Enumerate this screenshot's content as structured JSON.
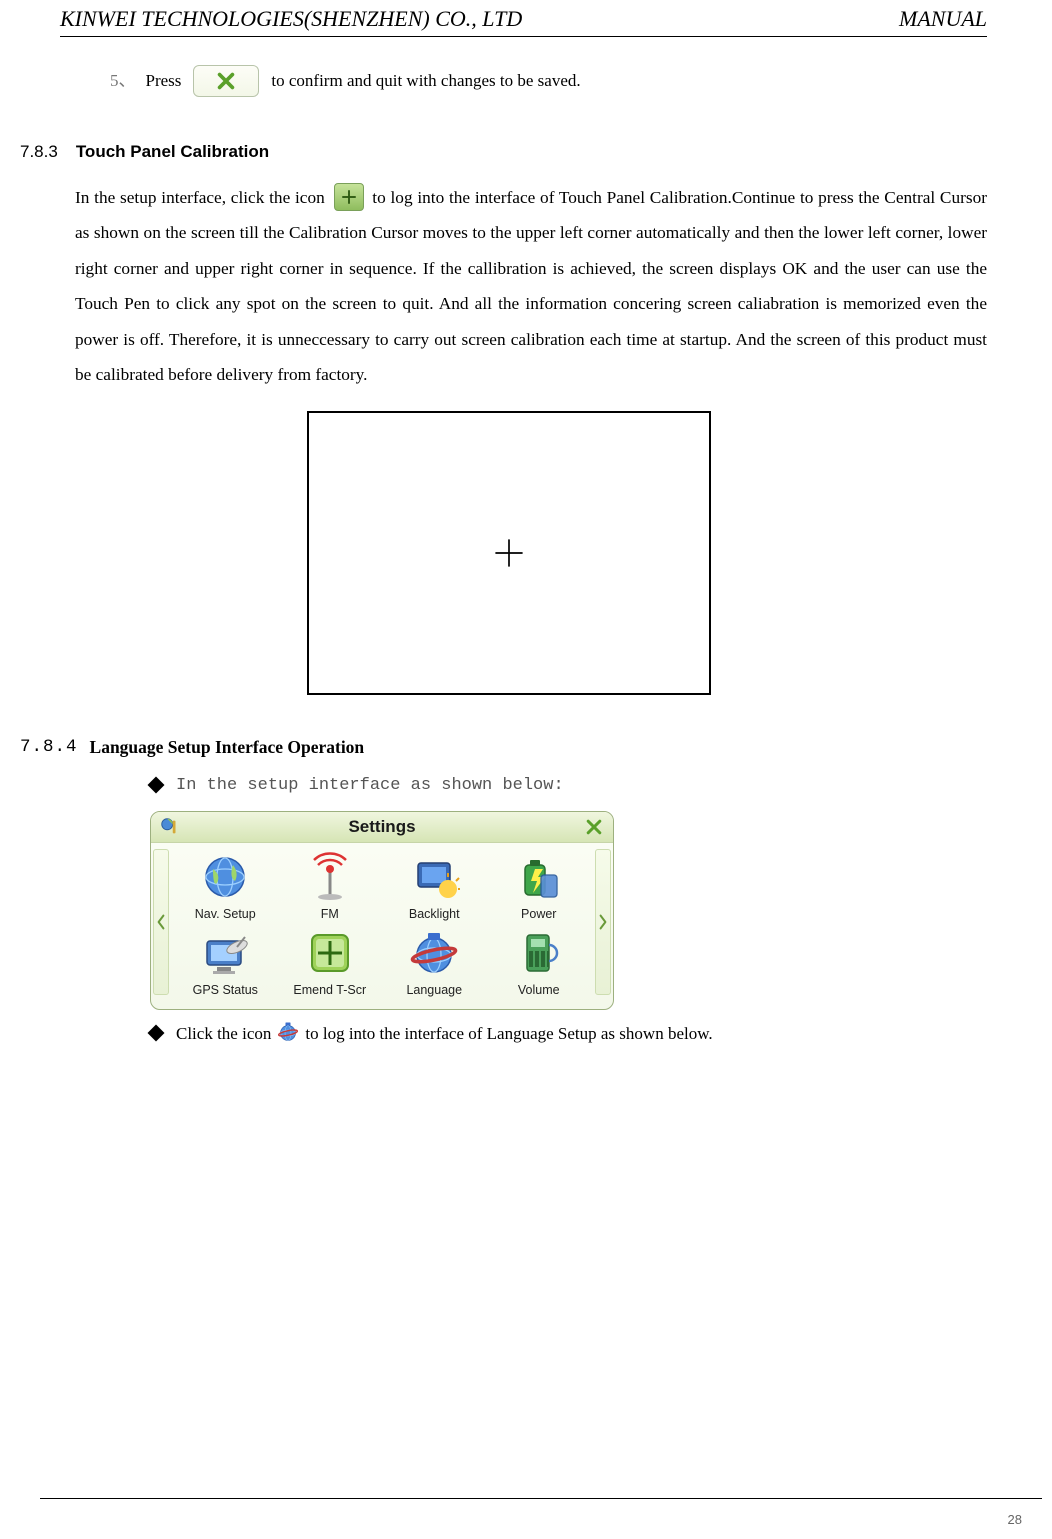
{
  "header": {
    "company": "KINWEI TECHNOLOGIES(SHENZHEN) CO., LTD",
    "doc_type": "MANUAL"
  },
  "page_number": "28",
  "step5": {
    "number": "5、",
    "before": "Press",
    "after": "to confirm and quit with changes to be saved."
  },
  "section_783": {
    "number": "7.8.3",
    "title": "Touch Panel Calibration",
    "para_a": "In the setup interface, click the icon",
    "para_b": "to log into the interface of Touch Panel Calibration.Continue to press the Central Cursor as shown on the screen till the Calibration Cursor moves to the upper left corner automatically and then the lower left corner, lower right corner and upper right corner in sequence. If the callibration is achieved, the screen displays OK and the user can use the Touch Pen to click any spot on the screen to quit. And all the information concering screen caliabration is memorized even the power is off. Therefore, it is unneccessary to carry out screen calibration each time at startup. And the screen of this product must be calibrated before delivery from factory."
  },
  "section_784": {
    "number": "7.8.4",
    "title": "Language Setup Interface Operation",
    "bullet1": "In the setup interface as shown below:",
    "bullet2_a": "Click the icon",
    "bullet2_b": "to log into the interface of Language Setup as shown below."
  },
  "settings_window": {
    "title": "Settings",
    "items": [
      {
        "label": "Nav. Setup",
        "icon": "globe-icon"
      },
      {
        "label": "FM",
        "icon": "antenna-icon"
      },
      {
        "label": "Backlight",
        "icon": "backlight-icon"
      },
      {
        "label": "Power",
        "icon": "power-icon"
      },
      {
        "label": "GPS Status",
        "icon": "gps-icon"
      },
      {
        "label": "Emend T-Scr",
        "icon": "emend-icon"
      },
      {
        "label": "Language",
        "icon": "language-icon"
      },
      {
        "label": "Volume",
        "icon": "volume-icon"
      }
    ]
  }
}
